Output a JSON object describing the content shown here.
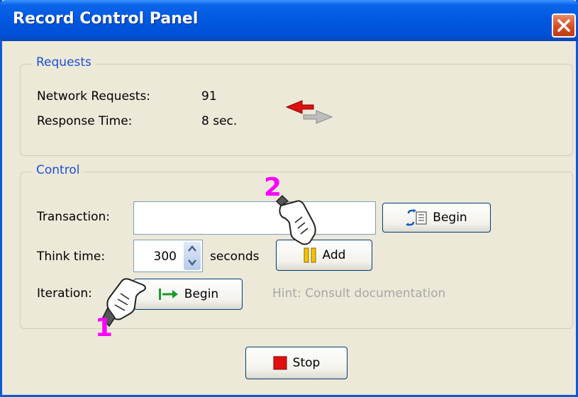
{
  "window": {
    "title": "Record Control Panel"
  },
  "requests": {
    "legend": "Requests",
    "network_label": "Network Requests:",
    "network_value": "91",
    "response_label": "Response Time:",
    "response_value": "8 sec."
  },
  "control": {
    "legend": "Control",
    "transaction_label": "Transaction:",
    "transaction_value": "",
    "transaction_begin": "Begin",
    "think_label": "Think time:",
    "think_value": "300",
    "think_unit": "seconds",
    "add_label": "Add",
    "iteration_label": "Iteration:",
    "iteration_begin": "Begin",
    "hint": "Hint: Consult documentation"
  },
  "stop_label": "Stop",
  "callouts": {
    "one": "1",
    "two": "2"
  },
  "colors": {
    "title_bar": "#0058e0",
    "callout": "#ff00ff",
    "group_legend": "#1c4ed8",
    "stop_icon": "#e01010"
  }
}
